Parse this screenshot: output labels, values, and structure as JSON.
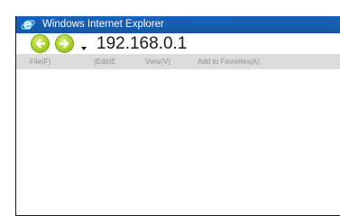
{
  "window": {
    "title": "Windows Internet Explorer",
    "title_bar_color": "#1a63b8",
    "icons": {
      "app": "internet-explorer-icon",
      "back": "back-arrow-icon",
      "forward": "forward-arrow-icon",
      "history": "chevron-down-icon"
    }
  },
  "address_bar": {
    "value": "192.168.0.1"
  },
  "menu": {
    "items": [
      {
        "label": "File(F)"
      },
      {
        "label": "(Edit)E"
      },
      {
        "label": "View(V)"
      },
      {
        "label": "Add to Favorites(A)"
      }
    ],
    "text_color": "#8f8f8f",
    "background": "#dcdcdc"
  },
  "nav_button_color": "#a9d12a"
}
